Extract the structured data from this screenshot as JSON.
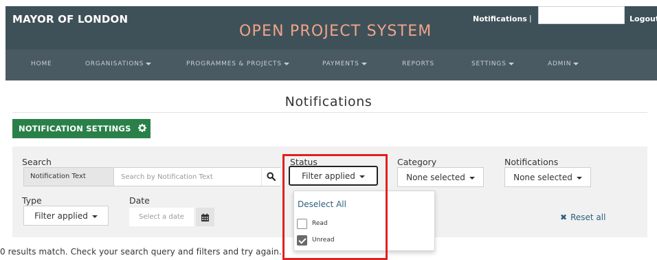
{
  "header": {
    "brand": "MAYOR OF LONDON",
    "system_title": "OPEN PROJECT SYSTEM",
    "notifications_link": "Notifications",
    "separator": "|",
    "logout": "Logout"
  },
  "nav": {
    "items": [
      {
        "label": "HOME",
        "has_caret": false
      },
      {
        "label": "ORGANISATIONS",
        "has_caret": true
      },
      {
        "label": "PROGRAMMES & PROJECTS",
        "has_caret": true
      },
      {
        "label": "PAYMENTS",
        "has_caret": true
      },
      {
        "label": "REPORTS",
        "has_caret": false
      },
      {
        "label": "SETTINGS",
        "has_caret": true
      },
      {
        "label": "ADMIN",
        "has_caret": true
      }
    ]
  },
  "page": {
    "title": "Notifications",
    "settings_button": "NOTIFICATION SETTINGS"
  },
  "filters": {
    "search_label": "Search",
    "search_addon": "Notification Text",
    "search_placeholder": "Search by Notification Text",
    "status_label": "Status",
    "status_value": "Filter applied",
    "category_label": "Category",
    "category_value": "None selected",
    "notifications_label": "Notifications",
    "notifications_value": "None selected",
    "type_label": "Type",
    "type_value": "Filter applied",
    "date_label": "Date",
    "date_placeholder": "Select a date",
    "reset_all": "Reset all"
  },
  "status_dropdown": {
    "deselect_all": "Deselect All",
    "options": [
      {
        "label": "Read",
        "checked": false
      },
      {
        "label": "Unread",
        "checked": true
      }
    ]
  },
  "results_message": "0 results match. Check your search query and filters and try again.",
  "colors": {
    "header_bg": "#3f5158",
    "nav_bg": "#4a5a62",
    "title_accent": "#f0a48a",
    "primary_button": "#2a8049",
    "link": "#2c5f7c",
    "highlight": "#e02020"
  }
}
